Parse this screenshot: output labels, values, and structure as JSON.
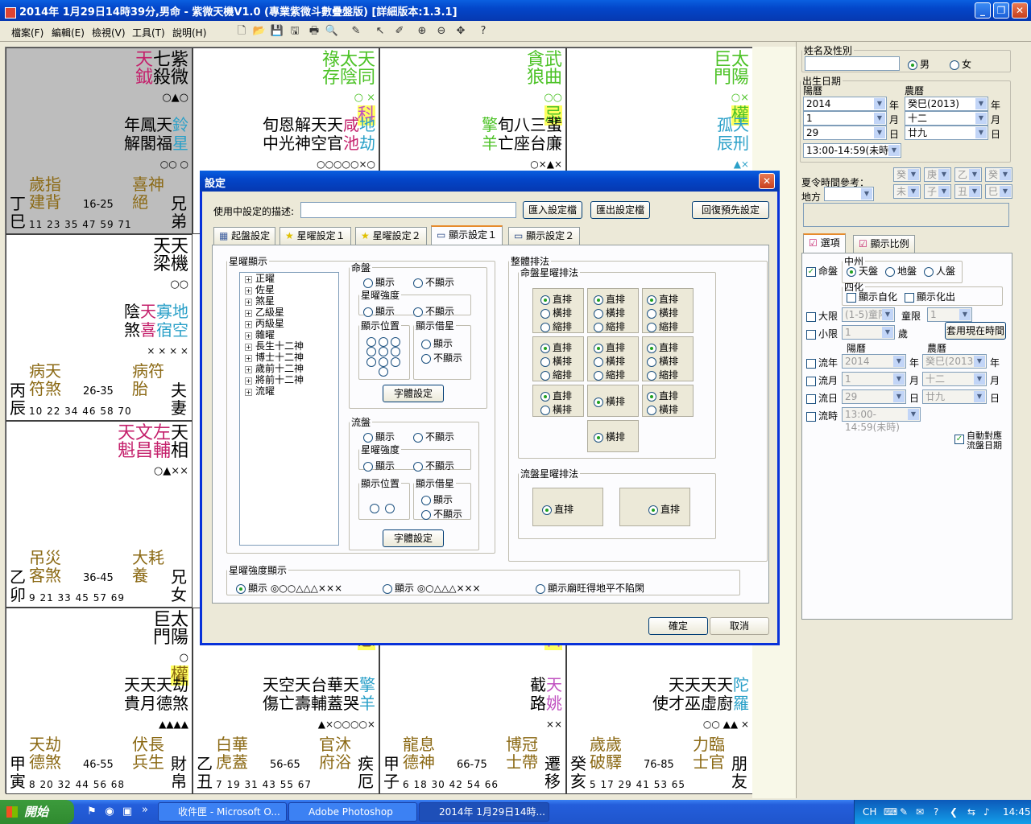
{
  "window": {
    "title": "2014年 1月29日14時39分,男命 - 紫微天機V1.0 (專業紫微斗數疊盤版) [詳細版本:1.3.1]"
  },
  "menu": [
    "檔案(F)",
    "編輯(E)",
    "檢視(V)",
    "工具(T)",
    "說明(H)"
  ],
  "chart": {
    "cells": [
      {
        "stars": "天紫<br>鉞殺微",
        "s2": "年鳳天鈴<br>解閣福星",
        "gz": "丁巳",
        "pal": "兄弟",
        "god": "歲指建背",
        "god2": "喜神絕",
        "rng": "16-25",
        "ages": "11 23 35 47 59 71"
      },
      {
        "stars": "祿太天<br>存陰同",
        "s2": "旬恩解天天咸地<br>中光神空官池劫",
        "gz": "",
        "pal": "",
        "god": "",
        "god2": "",
        "rng": "",
        "ages": ""
      },
      {
        "stars": "貪武<br>狼曲",
        "s2": "擎旬八三蜚<br>羊亡座台廉",
        "gz": "",
        "pal": "",
        "god": "",
        "god2": "",
        "rng": "",
        "ages": ""
      },
      {
        "stars": "巨太<br>門陽",
        "s2": "孤天<br>辰刑",
        "gz": "",
        "pal": "",
        "god": "",
        "god2": "",
        "rng": "",
        "ages": ""
      },
      {
        "stars": "天天<br>梁機",
        "s2": "陰天寡地<br>煞喜宿空",
        "gz": "丙辰",
        "pal": "夫妻",
        "god": "病天符煞",
        "god2": "病符胎",
        "rng": "26-35",
        "ages": "10 22 34 46 58 70"
      },
      {
        "stars": "天文左天<br>魁昌輔相",
        "s2": "",
        "gz": "乙卯",
        "pal": "兄女",
        "god": "吊災客煞",
        "god2": "大耗養",
        "rng": "36-45",
        "ages": "9 21 33 45 57 69"
      },
      {
        "stars": "巨太<br>門陽",
        "s2": "天天天劫<br>貴月德煞",
        "gz": "甲寅",
        "pal": "財帛",
        "god": "天劫德煞",
        "god2": "伏長兵生",
        "rng": "46-55",
        "ages": "8 20 32 44 56 68"
      },
      {
        "stars": "",
        "s2": "天空天台華天擎<br>傷亡壽輔蓋哭羊",
        "gz": "乙丑",
        "pal": "疾厄",
        "god": "白華虎蓋",
        "god2": "官沐府浴",
        "rng": "56-65",
        "ages": "7 19 31 43 55 67"
      },
      {
        "stars": "",
        "s2": "截天<br>路姚",
        "gz": "甲子",
        "pal": "遷移",
        "god": "龍息德神",
        "god2": "博冠士帶",
        "rng": "66-75",
        "ages": "6 18 30 42 54 66"
      },
      {
        "stars": "",
        "s2": "天天天天陀<br>使才巫虛廚羅",
        "gz": "癸亥",
        "pal": "朋友",
        "god": "歲歲破驛",
        "god2": "力臨士官",
        "rng": "76-85",
        "ages": "5 17 29 41 53 65"
      }
    ]
  },
  "right": {
    "name_legend": "姓名及性別",
    "male": "男",
    "female": "女",
    "birth_legend": "出生日期",
    "solar": "陽曆",
    "lunar": "農曆",
    "year": "2014",
    "lyear": "癸巳(2013)",
    "month": "1",
    "lmonth": "十二",
    "day": "29",
    "lday": "廿九",
    "hour": "13:00-14:59(未時)",
    "u_year": "年",
    "u_month": "月",
    "u_day": "日",
    "dst": "夏令時間參考：",
    "place": "地方",
    "gz_boxes": [
      "癸",
      "庚",
      "乙",
      "癸",
      "未",
      "子",
      "丑",
      "巳"
    ],
    "tab_opts": "選項",
    "tab_ratio": "顯示比例",
    "mingpan": "命盤",
    "zhongzhou": "中州",
    "tianpan": "天盤",
    "dipan": "地盤",
    "renpan": "人盤",
    "sihua": "四化",
    "show_self": "顯示自化",
    "show_out": "顯示化出",
    "daxian": "大限",
    "daxian_val": "(1-5)童限",
    "tongxian": "童限",
    "tongxian_val": "1",
    "xiaoxian": "小限",
    "xiaoxian_val": "1",
    "sui": "歲",
    "use_now": "套用現在時間",
    "liunian": "流年",
    "liuyue": "流月",
    "liuri": "流日",
    "liushi": "流時",
    "ln_year": "2014",
    "ln_lyear": "癸巳(2013)",
    "ln_month": "1",
    "ln_lmonth": "十二",
    "ln_day": "29",
    "ln_lday": "廿九",
    "ln_hour": "13:00-14:59(未時)",
    "auto": "自動對應流盤日期"
  },
  "dialog": {
    "title": "設定",
    "desc_label": "使用中設定的描述:",
    "import": "匯入設定檔",
    "export": "匯出設定檔",
    "reset": "回復預先設定",
    "tabs": [
      "起盤設定",
      "星曜設定１",
      "星曜設定２",
      "顯示設定１",
      "顯示設定２"
    ],
    "star_display": "星曜顯示",
    "tree": [
      "正曜",
      "佐星",
      "煞星",
      "乙級星",
      "丙級星",
      "雜曜",
      "長生十二神",
      "博士十二神",
      "歲前十二神",
      "將前十二神",
      "流曜"
    ],
    "mingpan": "命盤",
    "show": "顯示",
    "hide": "不顯示",
    "strength": "星曜強度",
    "pos": "顯示位置",
    "borrow": "顯示借星",
    "font_btn": "字體設定",
    "liupan": "流盤",
    "layout": "整體排法",
    "ming_layout": "命盤星曜排法",
    "liu_layout": "流盤星曜排法",
    "zhi": "直排",
    "heng": "橫排",
    "suo": "縮排",
    "strength_display": "星曜強度顯示",
    "opt1": "顯示 ◎○○△△△×××",
    "opt2": "顯示 ◎○△△△×××",
    "opt3": "顯示廟旺得地平不陷閑",
    "ok": "確定",
    "cancel": "取消"
  },
  "taskbar": {
    "start": "開始",
    "tasks": [
      "收件匣 - Microsoft O...",
      "Adobe Photoshop",
      "2014年 1月29日14時..."
    ],
    "lang": "CH",
    "time": "14:45"
  }
}
